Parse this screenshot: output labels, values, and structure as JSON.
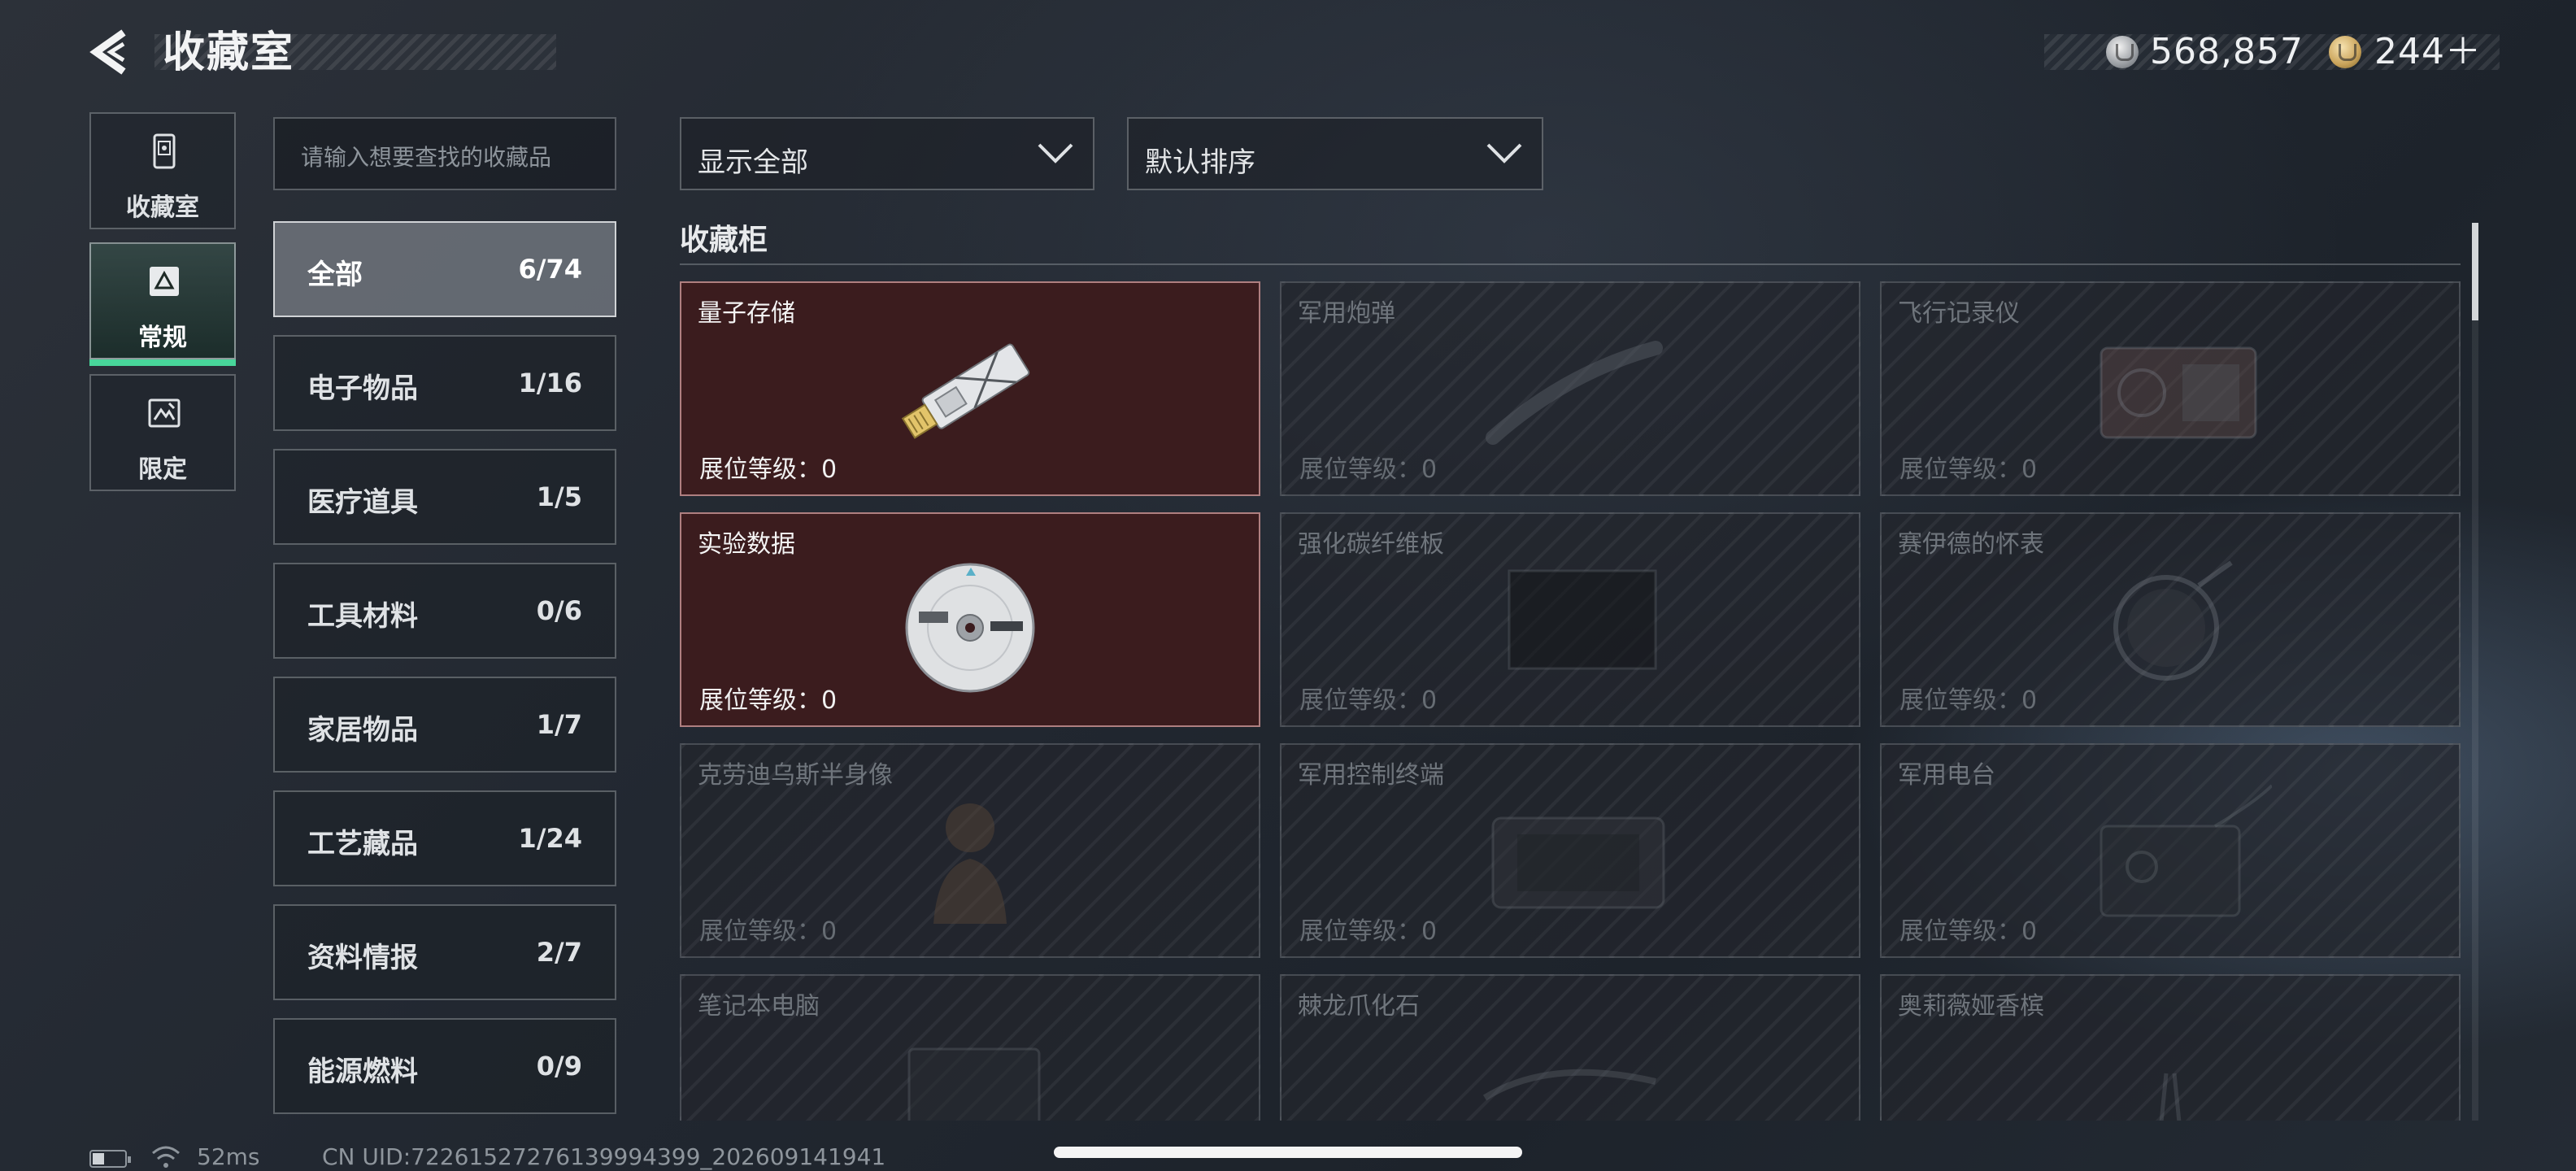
{
  "header": {
    "title": "收藏室",
    "back_icon": "back-arrow-icon"
  },
  "currency": {
    "silver_icon": "silver-coin-icon",
    "silver_value": "568,857",
    "gold_icon": "gold-coin-icon",
    "gold_value": "244＋"
  },
  "mode_tabs": [
    {
      "label": "收藏室",
      "icon": "display-case-icon"
    },
    {
      "label": "常规",
      "icon": "warning-box-icon",
      "active": true
    },
    {
      "label": "限定",
      "icon": "limited-box-icon"
    }
  ],
  "search": {
    "placeholder": "请输入想要查找的收藏品"
  },
  "categories": [
    {
      "label": "全部",
      "count": "6/74",
      "active": true
    },
    {
      "label": "电子物品",
      "count": "1/16"
    },
    {
      "label": "医疗道具",
      "count": "1/5"
    },
    {
      "label": "工具材料",
      "count": "0/6"
    },
    {
      "label": "家居物品",
      "count": "1/7"
    },
    {
      "label": "工艺藏品",
      "count": "1/24"
    },
    {
      "label": "资料情报",
      "count": "2/7"
    },
    {
      "label": "能源燃料",
      "count": "0/9"
    }
  ],
  "filters": {
    "show_label": "显示全部",
    "sort_label": "默认排序"
  },
  "section": {
    "title": "收藏柜"
  },
  "items": [
    {
      "name": "量子存储",
      "level": "展位等级：0",
      "owned": true,
      "icon": "usb-drive-icon"
    },
    {
      "name": "军用炮弹",
      "level": "展位等级：0",
      "owned": false,
      "icon": "artillery-shell-icon"
    },
    {
      "name": "飞行记录仪",
      "level": "展位等级：0",
      "owned": false,
      "icon": "flight-recorder-icon"
    },
    {
      "name": "实验数据",
      "level": "展位等级：0",
      "owned": true,
      "icon": "disc-icon"
    },
    {
      "name": "强化碳纤维板",
      "level": "展位等级：0",
      "owned": false,
      "icon": "carbon-plate-icon"
    },
    {
      "name": "赛伊德的怀表",
      "level": "展位等级：0",
      "owned": false,
      "icon": "pocket-watch-icon"
    },
    {
      "name": "克劳迪乌斯半身像",
      "level": "展位等级：0",
      "owned": false,
      "icon": "bust-icon"
    },
    {
      "name": "军用控制终端",
      "level": "展位等级：0",
      "owned": false,
      "icon": "control-terminal-icon"
    },
    {
      "name": "军用电台",
      "level": "展位等级：0",
      "owned": false,
      "icon": "radio-icon"
    },
    {
      "name": "笔记本电脑",
      "level": "",
      "owned": false,
      "icon": "laptop-icon"
    },
    {
      "name": "棘龙爪化石",
      "level": "",
      "owned": false,
      "icon": "fossil-icon"
    },
    {
      "name": "奥莉薇娅香槟",
      "level": "",
      "owned": false,
      "icon": "champagne-icon"
    }
  ],
  "status": {
    "ping": "52ms",
    "uid": "CN UID:72261527276139994399_202609141941"
  },
  "colors": {
    "owned_card": "#3b1c1e",
    "active_tab_accent": "#48d69a"
  }
}
